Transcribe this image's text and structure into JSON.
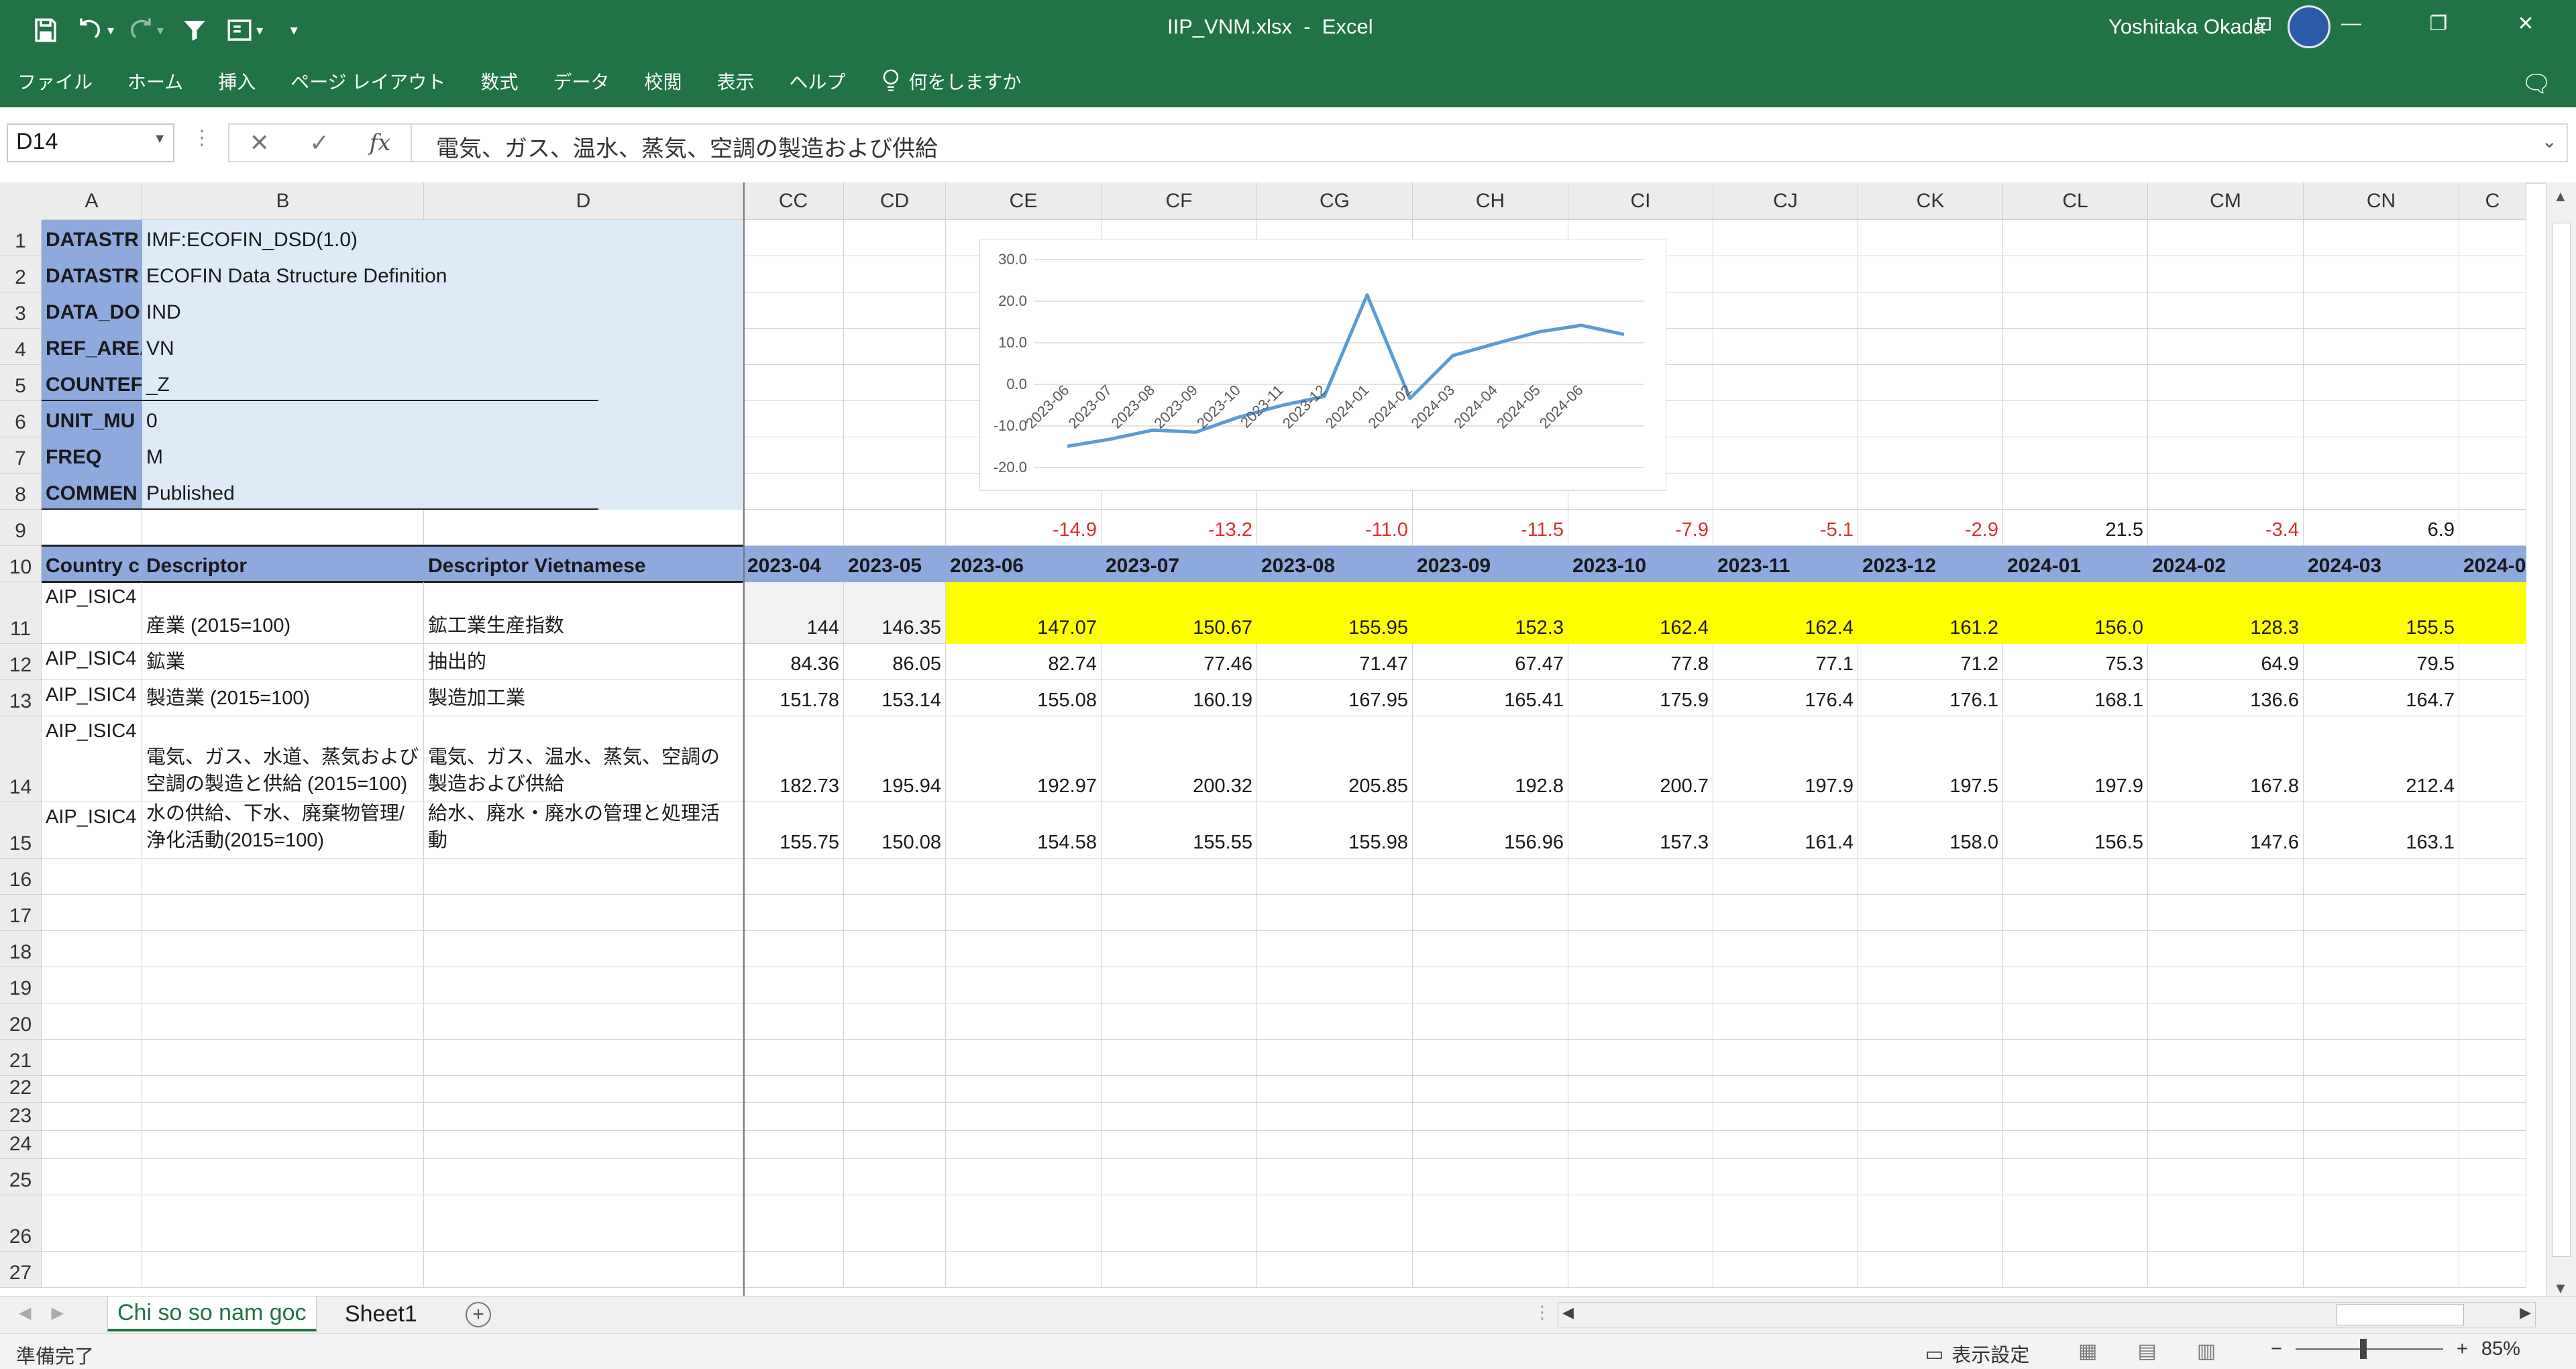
{
  "titlebar": {
    "doc_title": "IIP_VNM.xlsx  -  Excel",
    "user_name": "Yoshitaka Okada"
  },
  "menu": [
    "ファイル",
    "ホーム",
    "挿入",
    "ページ レイアウト",
    "数式",
    "データ",
    "校閲",
    "表示",
    "ヘルプ"
  ],
  "tellme": "何をしますか",
  "formula_bar": {
    "name_box": "D14",
    "formula": "電気、ガス、温水、蒸気、空調の製造および供給"
  },
  "columns": [
    "A",
    "B",
    "D",
    "CC",
    "CD",
    "CE",
    "CF",
    "CG",
    "CH",
    "CI",
    "CJ",
    "CK",
    "CL",
    "CM",
    "CN",
    "C"
  ],
  "rows": [
    "1",
    "2",
    "3",
    "4",
    "5",
    "6",
    "7",
    "8",
    "9",
    "10",
    "11",
    "12",
    "13",
    "14",
    "15",
    "16",
    "17",
    "18",
    "19",
    "20",
    "21",
    "22",
    "23",
    "24",
    "25",
    "26",
    "27"
  ],
  "metadata": [
    {
      "key": "DATASTR",
      "value": "IMF:ECOFIN_DSD(1.0)"
    },
    {
      "key": "DATASTR",
      "value": "ECOFIN Data Structure Definition"
    },
    {
      "key": "DATA_DO",
      "value": "IND"
    },
    {
      "key": "REF_AREA",
      "value": "VN"
    },
    {
      "key": "COUNTEF",
      "value": "_Z"
    },
    {
      "key": "UNIT_MU",
      "value": "0"
    },
    {
      "key": "FREQ",
      "value": "M"
    },
    {
      "key": "COMMEN",
      "value": "Published"
    }
  ],
  "row9": [
    "",
    "",
    "-14.9",
    "-13.2",
    "-11.0",
    "-11.5",
    "-7.9",
    "-5.1",
    "-2.9",
    "21.5",
    "-3.4",
    "6.9"
  ],
  "header_row": {
    "a": "Country c",
    "b": "Descriptor",
    "d": "Descriptor Vietnamese",
    "periods": [
      "2023-04",
      "2023-05",
      "2023-06",
      "2023-07",
      "2023-08",
      "2023-09",
      "2023-10",
      "2023-11",
      "2023-12",
      "2024-01",
      "2024-02",
      "2024-03",
      "2024-0"
    ]
  },
  "data_rows": [
    {
      "code": "AIP_ISIC4",
      "desc": "産業 (2015=100)",
      "desc_vn": "鉱工業生産指数",
      "values": [
        "144",
        "146.35",
        "147.07",
        "150.67",
        "155.95",
        "152.3",
        "162.4",
        "162.4",
        "161.2",
        "156.0",
        "128.3",
        "155.5"
      ]
    },
    {
      "code": "AIP_ISIC4",
      "desc": "鉱業",
      "desc_vn": "抽出的",
      "values": [
        "84.36",
        "86.05",
        "82.74",
        "77.46",
        "71.47",
        "67.47",
        "77.8",
        "77.1",
        "71.2",
        "75.3",
        "64.9",
        "79.5"
      ]
    },
    {
      "code": "AIP_ISIC4",
      "desc": "製造業 (2015=100)",
      "desc_vn": "製造加工業",
      "values": [
        "151.78",
        "153.14",
        "155.08",
        "160.19",
        "167.95",
        "165.41",
        "175.9",
        "176.4",
        "176.1",
        "168.1",
        "136.6",
        "164.7"
      ]
    },
    {
      "code": "AIP_ISIC4",
      "desc": "電気、ガス、水道、蒸気および空調の製造と供給 (2015=100)",
      "desc_vn": "電気、ガス、温水、蒸気、空調の製造および供給",
      "values": [
        "182.73",
        "195.94",
        "192.97",
        "200.32",
        "205.85",
        "192.8",
        "200.7",
        "197.9",
        "197.5",
        "197.9",
        "167.8",
        "212.4"
      ]
    },
    {
      "code": "AIP_ISIC4",
      "desc": "水の供給、下水、廃棄物管理/浄化活動(2015=100)",
      "desc_vn": "給水、廃水・廃水の管理と処理活動",
      "values": [
        "155.75",
        "150.08",
        "154.58",
        "155.55",
        "155.98",
        "156.96",
        "157.3",
        "161.4",
        "158.0",
        "156.5",
        "147.6",
        "163.1"
      ]
    }
  ],
  "chart_data": {
    "type": "line",
    "x": [
      "2023-06",
      "2023-07",
      "2023-08",
      "2023-09",
      "2023-10",
      "2023-11",
      "2023-12",
      "2024-01",
      "2024-02",
      "2024-03",
      "2024-04",
      "2024-05",
      "2024-06"
    ],
    "series": [
      {
        "values": [
          -14.9,
          -13.2,
          -11.0,
          -11.5,
          -7.9,
          -5.1,
          -2.9,
          21.5,
          -3.4,
          6.9,
          9.8,
          12.6,
          14.2,
          12.0
        ]
      }
    ],
    "yticks": [
      "30.0",
      "20.0",
      "10.0",
      "0.0",
      "-10.0",
      "-20.0"
    ],
    "ylim": [
      -20,
      30
    ],
    "line_color": "#5b9bd5",
    "negative_tick_color": "#ff0000"
  },
  "sheets": {
    "active": "Chi so so nam goc",
    "other": "Sheet1"
  },
  "status": {
    "ready": "準備完了",
    "view_settings": "表示設定",
    "zoom": "85%"
  }
}
